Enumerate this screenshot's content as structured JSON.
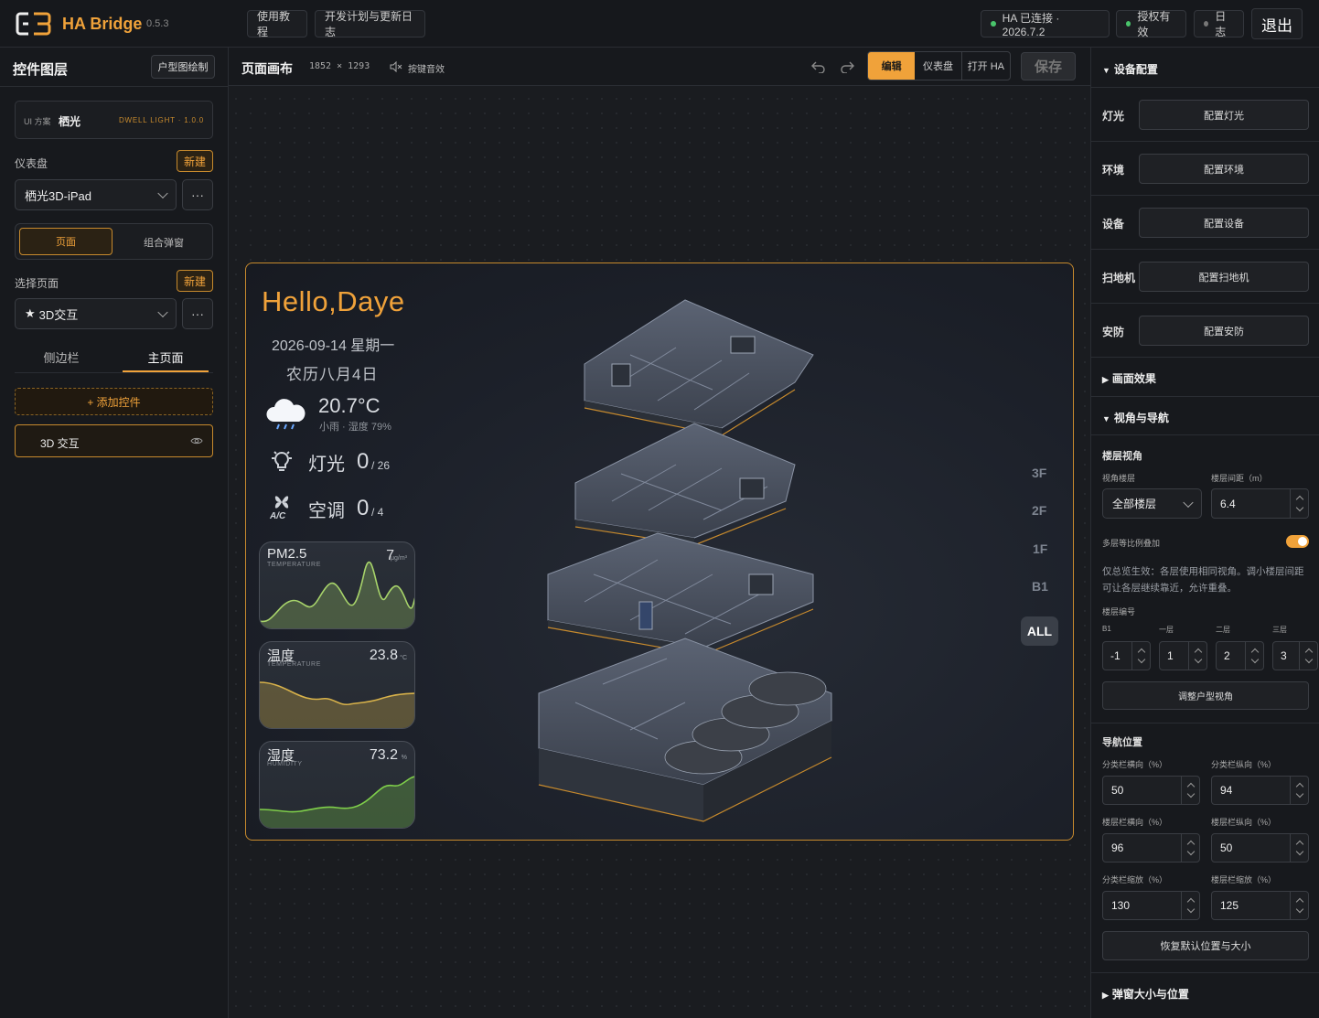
{
  "app": {
    "name": "HA Bridge",
    "version": "0.5.3"
  },
  "topbar": {
    "tutorial": "使用教程",
    "roadmap": "开发计划与更新日志",
    "ha_status": "HA 已连接 · 2026.7.2",
    "license": "授权有效",
    "log": "日志",
    "exit": "退出"
  },
  "left": {
    "title": "控件图层",
    "floorplan_btn": "户型图绘制",
    "scheme_label": "UI 方案",
    "scheme_name": "栖光",
    "scheme_tag": "DWELL LIGHT · 1.0.0",
    "dashboard_label": "仪表盘",
    "new": "新建",
    "dashboard_value": "栖光3D-iPad",
    "more": "···",
    "seg_page": "页面",
    "seg_popup": "组合弹窗",
    "page_label": "选择页面",
    "page_value": "3D交互",
    "tab_sidebar": "侧边栏",
    "tab_main": "主页面",
    "add_widget": "+ 添加控件",
    "layer_item": "3D 交互"
  },
  "canvas": {
    "title": "页面画布",
    "size": "1852 × 1293",
    "sound": "按键音效",
    "mode_edit": "编辑",
    "mode_dashboard": "仪表盘",
    "mode_open_ha": "打开 HA",
    "save": "保存"
  },
  "dashboard": {
    "greeting": "Hello,Daye",
    "date": "2026-09-14 星期一",
    "lunar": "农历八月4日",
    "weather_temp": "20.7°C",
    "weather_desc": "小雨 · 湿度 79%",
    "lights_label": "灯光",
    "lights_on": "0",
    "lights_total": "/ 26",
    "ac_label": "空调",
    "ac_on": "0",
    "ac_total": "/ 4",
    "ac_icon_text": "A/C",
    "cards": [
      {
        "title": "PM2.5",
        "sub": "TEMPERATURE",
        "value": "7",
        "unit": "μg/m³",
        "color": "#a7d36a"
      },
      {
        "title": "温度",
        "sub": "TEMPERATURE",
        "value": "23.8",
        "unit": "°C",
        "color": "#d8b24a"
      },
      {
        "title": "湿度",
        "sub": "HUMIDITY",
        "value": "73.2",
        "unit": "%",
        "color": "#7fcf4a"
      }
    ],
    "floors": [
      "3F",
      "2F",
      "1F",
      "B1",
      "ALL"
    ]
  },
  "right": {
    "device_config": "设备配置",
    "rows": [
      {
        "key": "灯光",
        "btn": "配置灯光"
      },
      {
        "key": "环境",
        "btn": "配置环境"
      },
      {
        "key": "设备",
        "btn": "配置设备"
      },
      {
        "key": "扫地机",
        "btn": "配置扫地机"
      },
      {
        "key": "安防",
        "btn": "配置安防"
      }
    ],
    "effects": "画面效果",
    "view_nav": "视角与导航",
    "floor_view": "楼层视角",
    "view_floor_label": "视角楼层",
    "floor_gap_label": "楼层间距（m）",
    "view_floor_value": "全部楼层",
    "floor_gap_value": "6.4",
    "overlay_label": "多层等比例叠加",
    "overlay_on": true,
    "note": "仅总览生效：各层使用相同视角。调小楼层间距可让各层继续靠近，允许重叠。",
    "floor_num_label": "楼层编号",
    "floor_nums": [
      {
        "label": "B1",
        "value": "-1"
      },
      {
        "label": "一层",
        "value": "1"
      },
      {
        "label": "二层",
        "value": "2"
      },
      {
        "label": "三层",
        "value": "3"
      }
    ],
    "adjust_btn": "调整户型视角",
    "nav_pos": "导航位置",
    "fields": [
      {
        "label": "分类栏横向（%）",
        "value": "50"
      },
      {
        "label": "分类栏纵向（%）",
        "value": "94"
      },
      {
        "label": "楼层栏横向（%）",
        "value": "96"
      },
      {
        "label": "楼层栏纵向（%）",
        "value": "50"
      },
      {
        "label": "分类栏缩放（%）",
        "value": "130"
      },
      {
        "label": "楼层栏缩放（%）",
        "value": "125"
      }
    ],
    "reset_btn": "恢复默认位置与大小",
    "popup_section": "弹窗大小与位置"
  },
  "colors": {
    "accent": "#f0a23a",
    "ok": "#49c46b"
  }
}
